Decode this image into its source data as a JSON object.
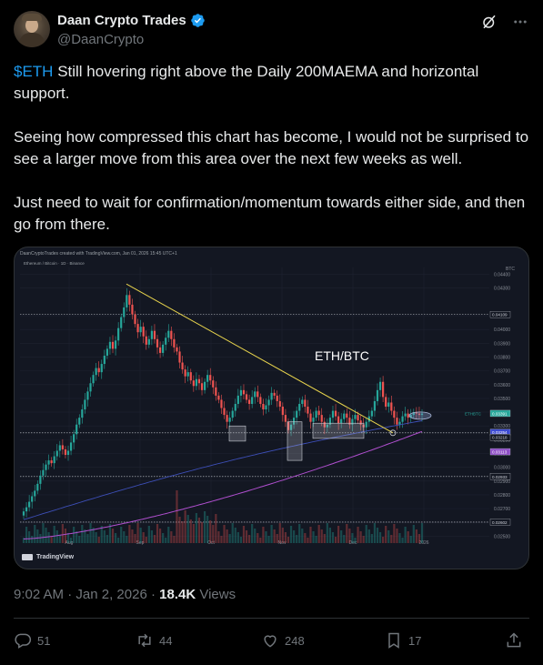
{
  "author": {
    "display_name": "Daan Crypto Trades",
    "handle": "@DaanCrypto"
  },
  "icons": {
    "verified": "verified-badge-icon",
    "grok": "grok-icon",
    "more": "more-icon",
    "reply": "reply-icon",
    "repost": "repost-icon",
    "like": "like-icon",
    "bookmark": "bookmark-icon",
    "share": "share-icon"
  },
  "colors": {
    "accent": "#1d9bf0",
    "text": "#e7e9ea",
    "secondary": "#71767b",
    "background": "#000000"
  },
  "tweet": {
    "cashtag": "$ETH",
    "line1_rest": " Still hovering right above the Daily 200MAEMA and horizontal support.",
    "paragraph2": "Seeing how compressed this chart has become, I would not be surprised to see a larger move from this area over the next few weeks as well.",
    "paragraph3": "Just need to wait for confirmation/momentum towards either side, and then go from there."
  },
  "media": {
    "header_text": "DaanCryptoTrades created with TradingView.com, Jan 01, 2026 15:45 UTC+1",
    "symbol_line": "Ethereum / Bitcoin · 1D · Binance",
    "annotation": "ETH/BTC",
    "brand": "TradingView",
    "currency_label": "BTC",
    "symbol_tag": "ETHBTC"
  },
  "chart_data": {
    "type": "candlestick",
    "symbol": "ETH/BTC",
    "timeframe": "1D",
    "x_tick_labels": [
      "Aug",
      "Sep",
      "Oct",
      "Nov",
      "Dec",
      "2026"
    ],
    "y_tick_labels": [
      "0.04400",
      "0.04300",
      "0.04100",
      "0.04000",
      "0.03900",
      "0.03800",
      "0.03700",
      "0.03600",
      "0.03500",
      "0.03400",
      "0.03300",
      "0.03200",
      "0.03100",
      "0.03000",
      "0.02900",
      "0.02800",
      "0.02700",
      "0.02600",
      "0.02500"
    ],
    "ylim": [
      0.0245,
      0.0445
    ],
    "highlighted_prices": [
      "0.04109",
      "0.03391",
      "0.03254",
      "0.03113",
      "0.03218",
      "0.02933",
      "0.02602"
    ],
    "current_price": 0.03391,
    "closes": [
      0.0268,
      0.0271,
      0.0275,
      0.0279,
      0.0283,
      0.0288,
      0.0294,
      0.0298,
      0.0302,
      0.0305,
      0.0303,
      0.0308,
      0.0312,
      0.0316,
      0.0313,
      0.0309,
      0.0312,
      0.0318,
      0.0324,
      0.0331,
      0.0336,
      0.0342,
      0.0349,
      0.0355,
      0.0361,
      0.0367,
      0.0372,
      0.0369,
      0.0375,
      0.0381,
      0.0386,
      0.0391,
      0.0386,
      0.0392,
      0.0401,
      0.0409,
      0.0416,
      0.0425,
      0.0418,
      0.0411,
      0.0404,
      0.0398,
      0.0402,
      0.0395,
      0.0389,
      0.0393,
      0.0399,
      0.0393,
      0.0387,
      0.0383,
      0.0389,
      0.0394,
      0.0399,
      0.0393,
      0.0387,
      0.0384,
      0.0376,
      0.0371,
      0.0366,
      0.0369,
      0.0363,
      0.0359,
      0.0364,
      0.0361,
      0.0356,
      0.0362,
      0.0367,
      0.0363,
      0.0358,
      0.0352,
      0.0349,
      0.0343,
      0.0338,
      0.0333,
      0.0336,
      0.0341,
      0.0346,
      0.0352,
      0.0356,
      0.0353,
      0.0349,
      0.0346,
      0.0351,
      0.0355,
      0.0351,
      0.0346,
      0.0342,
      0.0345,
      0.0349,
      0.0354,
      0.0352,
      0.0348,
      0.0344,
      0.0338,
      0.0333,
      0.0327,
      0.0331,
      0.0336,
      0.0341,
      0.0346,
      0.0349,
      0.0344,
      0.0339,
      0.0333,
      0.0336,
      0.0341,
      0.0338,
      0.0333,
      0.0329,
      0.0331,
      0.0336,
      0.0341,
      0.0337,
      0.0332,
      0.0335,
      0.0339,
      0.0336,
      0.0331,
      0.0335,
      0.0338,
      0.0334,
      0.0331,
      0.0329,
      0.0333,
      0.0337,
      0.0341,
      0.0348,
      0.0356,
      0.0362,
      0.0351,
      0.0344,
      0.0347,
      0.0341,
      0.0336,
      0.0331,
      0.0333,
      0.0337,
      0.0339,
      0.0336,
      0.0338,
      0.034,
      0.0339,
      0.0338,
      0.0339
    ]
  },
  "meta": {
    "time": "9:02 AM",
    "separator": " · ",
    "date": "Jan 2, 2026",
    "views_count": "18.4K",
    "views_label": " Views"
  },
  "actions": {
    "replies": "51",
    "reposts": "44",
    "likes": "248",
    "bookmarks": "17"
  }
}
